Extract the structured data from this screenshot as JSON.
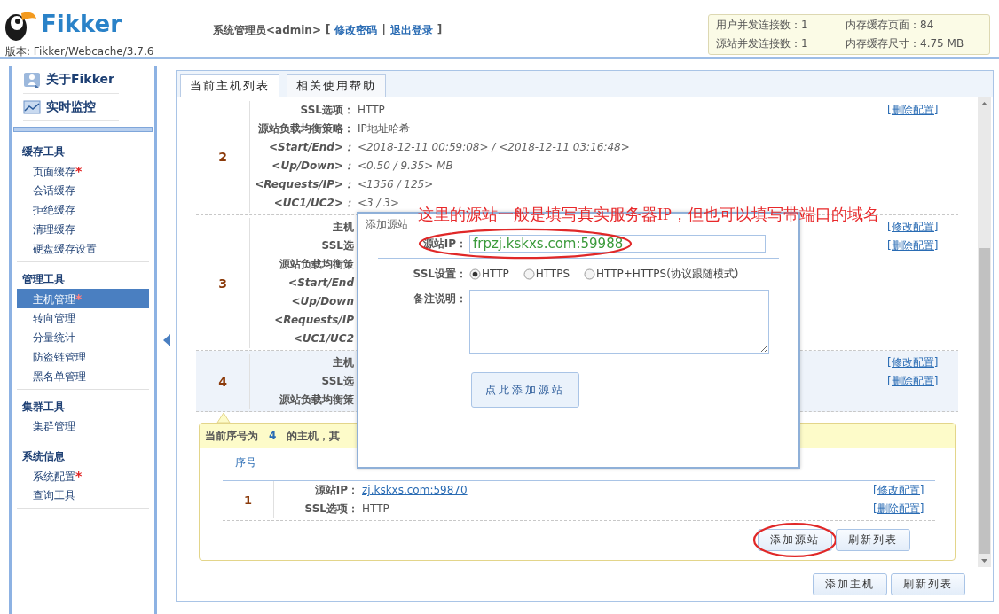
{
  "header": {
    "logo_text": "Fikker",
    "version": "版本: Fikker/Webcache/3.7.6",
    "user": "系统管理员<admin>",
    "open": "[",
    "separator": "|",
    "close": "]",
    "links": [
      {
        "label": "修改密码"
      },
      {
        "label": "退出登录"
      }
    ]
  },
  "stats": [
    {
      "text": "用户并发连接数：1"
    },
    {
      "text": "内存缓存页面：84"
    },
    {
      "text": "源站并发连接数：1"
    },
    {
      "text": "内存缓存尺寸：4.75 MB"
    }
  ],
  "sidebar": {
    "top_items": [
      {
        "label": "关于Fikker"
      },
      {
        "label": "实时监控"
      }
    ],
    "groups": [
      {
        "title": "缓存工具",
        "items": [
          {
            "label": "页面缓存",
            "badge": "*",
            "selected": false
          },
          {
            "label": "会话缓存",
            "selected": false
          },
          {
            "label": "拒绝缓存",
            "selected": false
          },
          {
            "label": "清理缓存",
            "selected": false
          },
          {
            "label": "硬盘缓存设置",
            "selected": false
          }
        ]
      },
      {
        "title": "管理工具",
        "items": [
          {
            "label": "主机管理",
            "badge": "*",
            "selected": true
          },
          {
            "label": "转向管理",
            "selected": false
          },
          {
            "label": "分量统计",
            "selected": false
          },
          {
            "label": "防盗链管理",
            "selected": false
          },
          {
            "label": "黑名单管理",
            "selected": false
          }
        ]
      },
      {
        "title": "集群工具",
        "items": [
          {
            "label": "集群管理",
            "selected": false
          }
        ]
      },
      {
        "title": "系统信息",
        "items": [
          {
            "label": "系统配置",
            "badge": "*",
            "selected": false
          },
          {
            "label": "查询工具",
            "selected": false
          }
        ]
      }
    ]
  },
  "tabs": [
    {
      "label": "当前主机列表",
      "selected": true
    },
    {
      "label": "相关使用帮助",
      "selected": false
    }
  ],
  "hosts": [
    {
      "number": "2",
      "selected": false,
      "fields": [
        {
          "kind": "plain",
          "label": "SSL选项：",
          "value": "HTTP"
        },
        {
          "kind": "plain",
          "label": "源站负载均衡策略：",
          "value": "IP地址哈希"
        },
        {
          "kind": "stat",
          "label": "<Start/End>：",
          "value": "<2018-12-11 00:59:08> / <2018-12-11 03:16:48>"
        },
        {
          "kind": "stat",
          "label": "<Up/Down>：",
          "value": "<0.50 / 9.35> MB"
        },
        {
          "kind": "stat",
          "label": "<Requests/IP>：",
          "value": "<1356 / 125>"
        },
        {
          "kind": "stat",
          "label": "<UC1/UC2>：",
          "value": "<3 / 3>"
        }
      ],
      "actions": [
        "[删除配置]"
      ]
    },
    {
      "number": "3",
      "selected": false,
      "fields": [
        {
          "kind": "plain",
          "label": "主机"
        },
        {
          "kind": "plain",
          "label": "SSL选"
        },
        {
          "kind": "plain",
          "label": "源站负载均衡策"
        },
        {
          "kind": "stat",
          "label": "<Start/End"
        },
        {
          "kind": "stat",
          "label": "<Up/Down"
        },
        {
          "kind": "stat",
          "label": "<Requests/IP"
        },
        {
          "kind": "stat",
          "label": "<UC1/UC2"
        }
      ],
      "actions": [
        "[修改配置]",
        "[删除配置]"
      ]
    },
    {
      "number": "4",
      "selected": true,
      "fields": [
        {
          "kind": "plain",
          "label": "主机"
        },
        {
          "kind": "plain",
          "label": "SSL选"
        },
        {
          "kind": "plain",
          "label": "源站负载均衡策"
        }
      ],
      "actions": [
        "[修改配置]",
        "[删除配置]"
      ]
    }
  ],
  "source_panel": {
    "prefix": "当前序号为",
    "number": "4",
    "suffix": "的主机，其",
    "columns": [
      "序号"
    ],
    "rows": [
      {
        "number": "1",
        "fields": [
          {
            "kind": "link",
            "label": "源站IP：",
            "value": "zj.kskxs.com:59870"
          },
          {
            "kind": "plain",
            "label": "SSL选项：",
            "value": "HTTP"
          }
        ],
        "actions": [
          "[修改配置]",
          "[删除配置]"
        ]
      }
    ],
    "buttons": [
      {
        "label": "添加源站",
        "circled": true
      },
      {
        "label": "刷新列表",
        "circled": false
      }
    ]
  },
  "buttons": [
    {
      "label": "添加主机"
    },
    {
      "label": "刷新列表"
    }
  ],
  "dialog": {
    "title": "添加源站",
    "fields": [
      {
        "kind": "text",
        "label": "源站IP：",
        "value": "frpzj.kskxs.com:59988",
        "circled": true
      },
      {
        "kind": "radio",
        "label": "SSL设置：",
        "options": [
          {
            "label": "HTTP",
            "selected": true
          },
          {
            "label": "HTTPS",
            "selected": false
          },
          {
            "label": "HTTP+HTTPS(协议跟随模式)",
            "selected": false
          }
        ]
      },
      {
        "kind": "textarea",
        "label": "备注说明："
      }
    ],
    "submit": "点此添加源站"
  },
  "annotation": {
    "note": "这里的源站一般是填写真实服务器IP，但也可以填写带端口的域名"
  }
}
